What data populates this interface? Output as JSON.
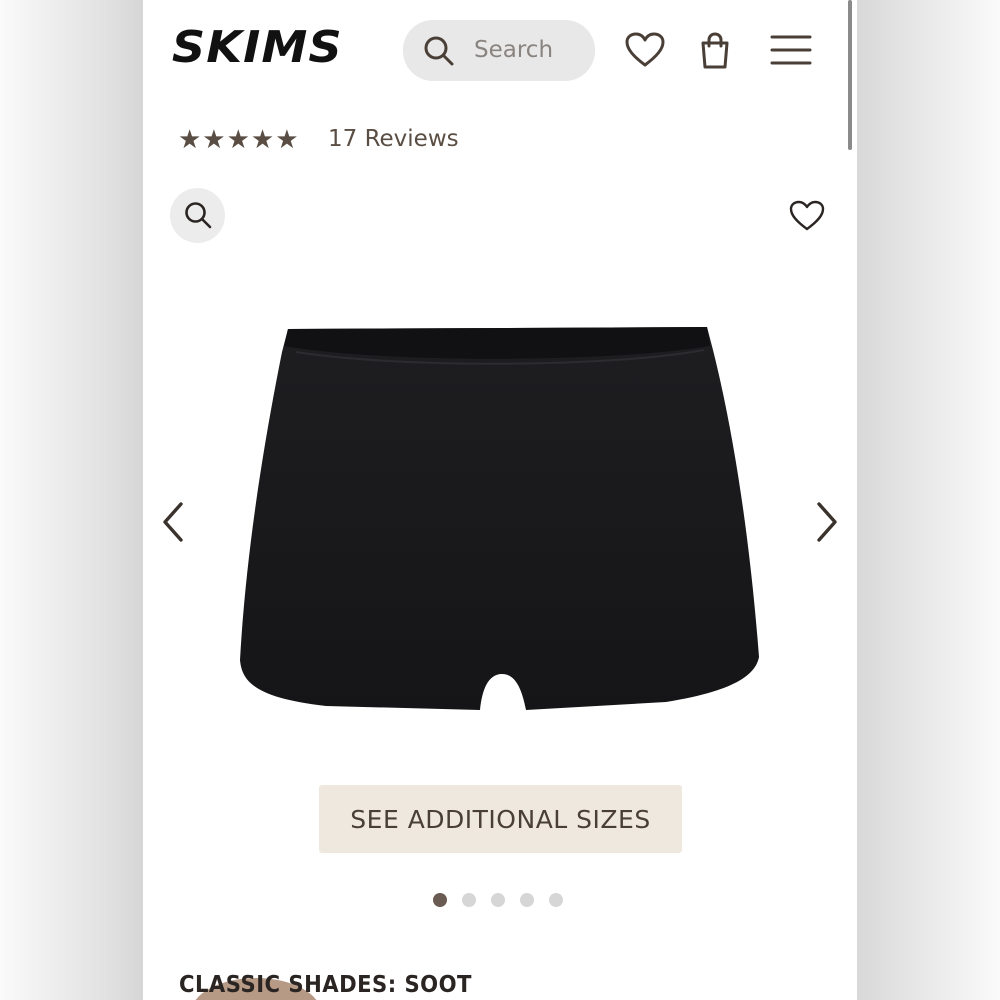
{
  "header": {
    "logo": "SKIMS",
    "search_placeholder": "Search",
    "icons": [
      "search-icon",
      "heart-icon",
      "bag-icon",
      "menu-icon"
    ]
  },
  "rating": {
    "stars": "★★★★★",
    "star_value": 5,
    "reviews_label": "17 Reviews"
  },
  "gallery": {
    "slide_count": 5,
    "active_slide": 1,
    "image_icon": "black-boy-shorts-product-image"
  },
  "sizes_button": {
    "label": "SEE ADDITIONAL SIZES"
  },
  "shade": {
    "label": "CLASSIC SHADES: SOOT"
  },
  "colors": {
    "brand_text": "#111111",
    "accent_brown": "#5a4e44",
    "sizes_bg": "#efe8df",
    "active_dot": "#6a5c52",
    "swatch": "#b79a86"
  }
}
